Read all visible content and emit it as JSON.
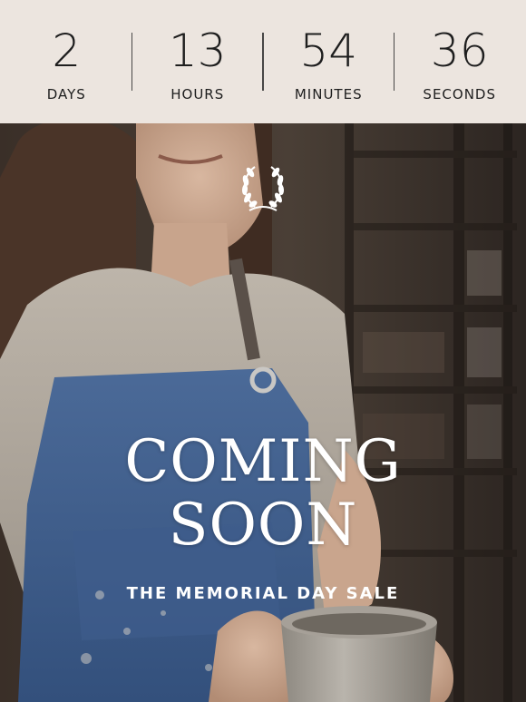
{
  "countdown": {
    "units": [
      {
        "value": "2",
        "label": "DAYS"
      },
      {
        "value": "13",
        "label": "HOURS"
      },
      {
        "value": "54",
        "label": "MINUTES"
      },
      {
        "value": "36",
        "label": "SECONDS"
      }
    ]
  },
  "hero": {
    "emblem": "laurel-wreath-icon",
    "headline_line1": "COMING",
    "headline_line2": "SOON",
    "subheadline": "THE MEMORIAL DAY SALE"
  },
  "colors": {
    "banner_bg": "#ece5df",
    "text_dark": "#1e1e1e",
    "hero_text": "#ffffff",
    "denim": "#3d5a86"
  }
}
